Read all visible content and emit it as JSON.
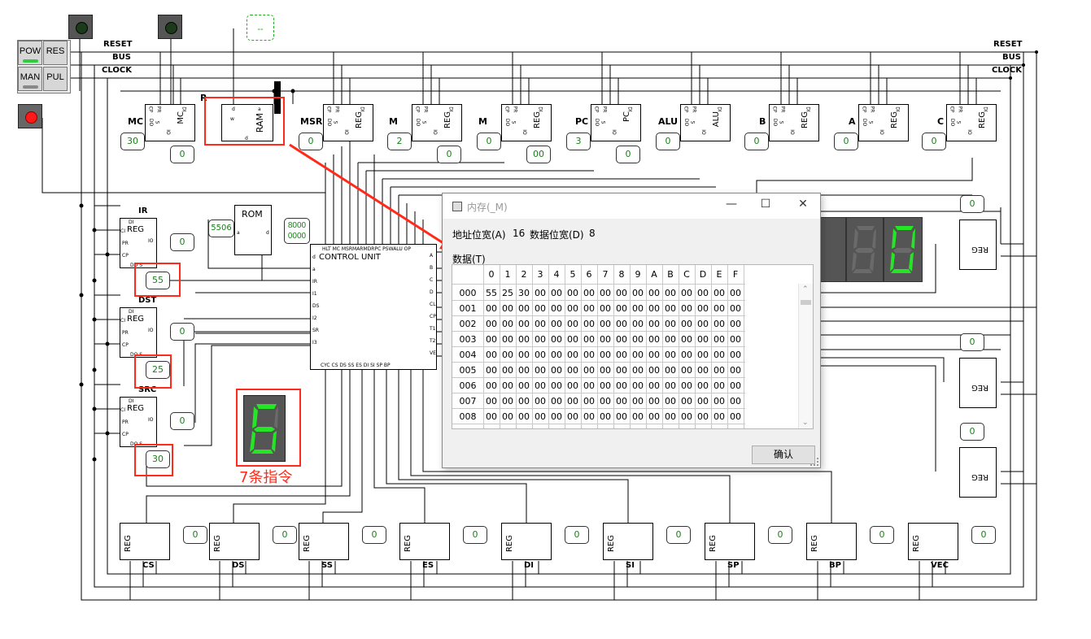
{
  "controls": {
    "pow": "POW",
    "res": "RES",
    "man": "MAN",
    "pul": "PUL",
    "accent_green": "#2ecc40",
    "reset_label": "RESET",
    "bus_label": "BUS",
    "clock_label": "CLOCK",
    "probe_value": "--"
  },
  "top_registers": [
    {
      "name": "MC",
      "reg_text": "MC",
      "value": "30",
      "side_value": "0"
    },
    {
      "name": "R",
      "reg_text": "RAM",
      "value": "",
      "side_value": ""
    },
    {
      "name": "MSR",
      "reg_text": "REG",
      "value": "0",
      "side_value": ""
    },
    {
      "name": "M",
      "reg_text": "REG",
      "value": "2",
      "side_value": "0"
    },
    {
      "name": "M",
      "reg_text": "REG",
      "value": "0",
      "side_value": "00"
    },
    {
      "name": "PC",
      "reg_text": "PC",
      "value": "3",
      "side_value": "0"
    },
    {
      "name": "ALU",
      "reg_text": "ALU",
      "value": "0",
      "side_value": ""
    },
    {
      "name": "B",
      "reg_text": "REG",
      "value": "0",
      "side_value": ""
    },
    {
      "name": "A",
      "reg_text": "REG",
      "value": "0",
      "side_value": ""
    },
    {
      "name": "C",
      "reg_text": "REG",
      "value": "0",
      "side_value": ""
    }
  ],
  "left_registers": [
    {
      "name": "IR",
      "reg_text": "REG",
      "value": "55",
      "side_value": "0"
    },
    {
      "name": "DST",
      "reg_text": "REG",
      "value": "25",
      "side_value": "0"
    },
    {
      "name": "SRC",
      "reg_text": "REG",
      "value": "30",
      "side_value": "0"
    }
  ],
  "rom": {
    "label": "ROM",
    "addr": "5506",
    "data_line1": "8000",
    "data_line2": "0000"
  },
  "control_unit": {
    "title": "CONTROL UNIT",
    "top_pins": "HLT MC  MSRMARMDRPC  PSWALU OP",
    "bottom_pins": "CYC CS   DS   SS   ES   DI   SI   SP   BP",
    "left_pins": [
      "d",
      "a",
      "IR",
      "I1",
      "DS",
      "I2",
      "SR",
      "I3"
    ],
    "right_pins": [
      "A",
      "B",
      "C",
      "D",
      "CL",
      "CP",
      "T1",
      "T2",
      "VE"
    ]
  },
  "seven_seg_digit": "6",
  "annotation": "7条指令",
  "bottom_registers": [
    {
      "name": "CS",
      "value": "0"
    },
    {
      "name": "DS",
      "value": "0"
    },
    {
      "name": "SS",
      "value": "0"
    },
    {
      "name": "ES",
      "value": "0"
    },
    {
      "name": "DI",
      "value": "0"
    },
    {
      "name": "SI",
      "value": "0"
    },
    {
      "name": "SP",
      "value": "0"
    },
    {
      "name": "BP",
      "value": "0"
    },
    {
      "name": "VEC",
      "value": "0"
    }
  ],
  "right_registers": [
    {
      "value": "0"
    },
    {
      "value": "0"
    },
    {
      "value": "0"
    }
  ],
  "dialog": {
    "title": "内存(_M)",
    "addr_width_label": "地址位宽(A)",
    "addr_width_value": "16",
    "data_width_label": "数据位宽(D)",
    "data_width_value": "8",
    "data_label": "数据(T)",
    "col_headers": [
      "0",
      "1",
      "2",
      "3",
      "4",
      "5",
      "6",
      "7",
      "8",
      "9",
      "A",
      "B",
      "C",
      "D",
      "E",
      "F"
    ],
    "rows": [
      {
        "addr": "000",
        "cells": [
          "55",
          "25",
          "30",
          "00",
          "00",
          "00",
          "00",
          "00",
          "00",
          "00",
          "00",
          "00",
          "00",
          "00",
          "00",
          "00"
        ]
      },
      {
        "addr": "001",
        "cells": [
          "00",
          "00",
          "00",
          "00",
          "00",
          "00",
          "00",
          "00",
          "00",
          "00",
          "00",
          "00",
          "00",
          "00",
          "00",
          "00"
        ]
      },
      {
        "addr": "002",
        "cells": [
          "00",
          "00",
          "00",
          "00",
          "00",
          "00",
          "00",
          "00",
          "00",
          "00",
          "00",
          "00",
          "00",
          "00",
          "00",
          "00"
        ]
      },
      {
        "addr": "003",
        "cells": [
          "00",
          "00",
          "00",
          "00",
          "00",
          "00",
          "00",
          "00",
          "00",
          "00",
          "00",
          "00",
          "00",
          "00",
          "00",
          "00"
        ]
      },
      {
        "addr": "004",
        "cells": [
          "00",
          "00",
          "00",
          "00",
          "00",
          "00",
          "00",
          "00",
          "00",
          "00",
          "00",
          "00",
          "00",
          "00",
          "00",
          "00"
        ]
      },
      {
        "addr": "005",
        "cells": [
          "00",
          "00",
          "00",
          "00",
          "00",
          "00",
          "00",
          "00",
          "00",
          "00",
          "00",
          "00",
          "00",
          "00",
          "00",
          "00"
        ]
      },
      {
        "addr": "006",
        "cells": [
          "00",
          "00",
          "00",
          "00",
          "00",
          "00",
          "00",
          "00",
          "00",
          "00",
          "00",
          "00",
          "00",
          "00",
          "00",
          "00"
        ]
      },
      {
        "addr": "007",
        "cells": [
          "00",
          "00",
          "00",
          "00",
          "00",
          "00",
          "00",
          "00",
          "00",
          "00",
          "00",
          "00",
          "00",
          "00",
          "00",
          "00"
        ]
      },
      {
        "addr": "008",
        "cells": [
          "00",
          "00",
          "00",
          "00",
          "00",
          "00",
          "00",
          "00",
          "00",
          "00",
          "00",
          "00",
          "00",
          "00",
          "00",
          "00"
        ]
      }
    ],
    "ok_label": "确认"
  }
}
